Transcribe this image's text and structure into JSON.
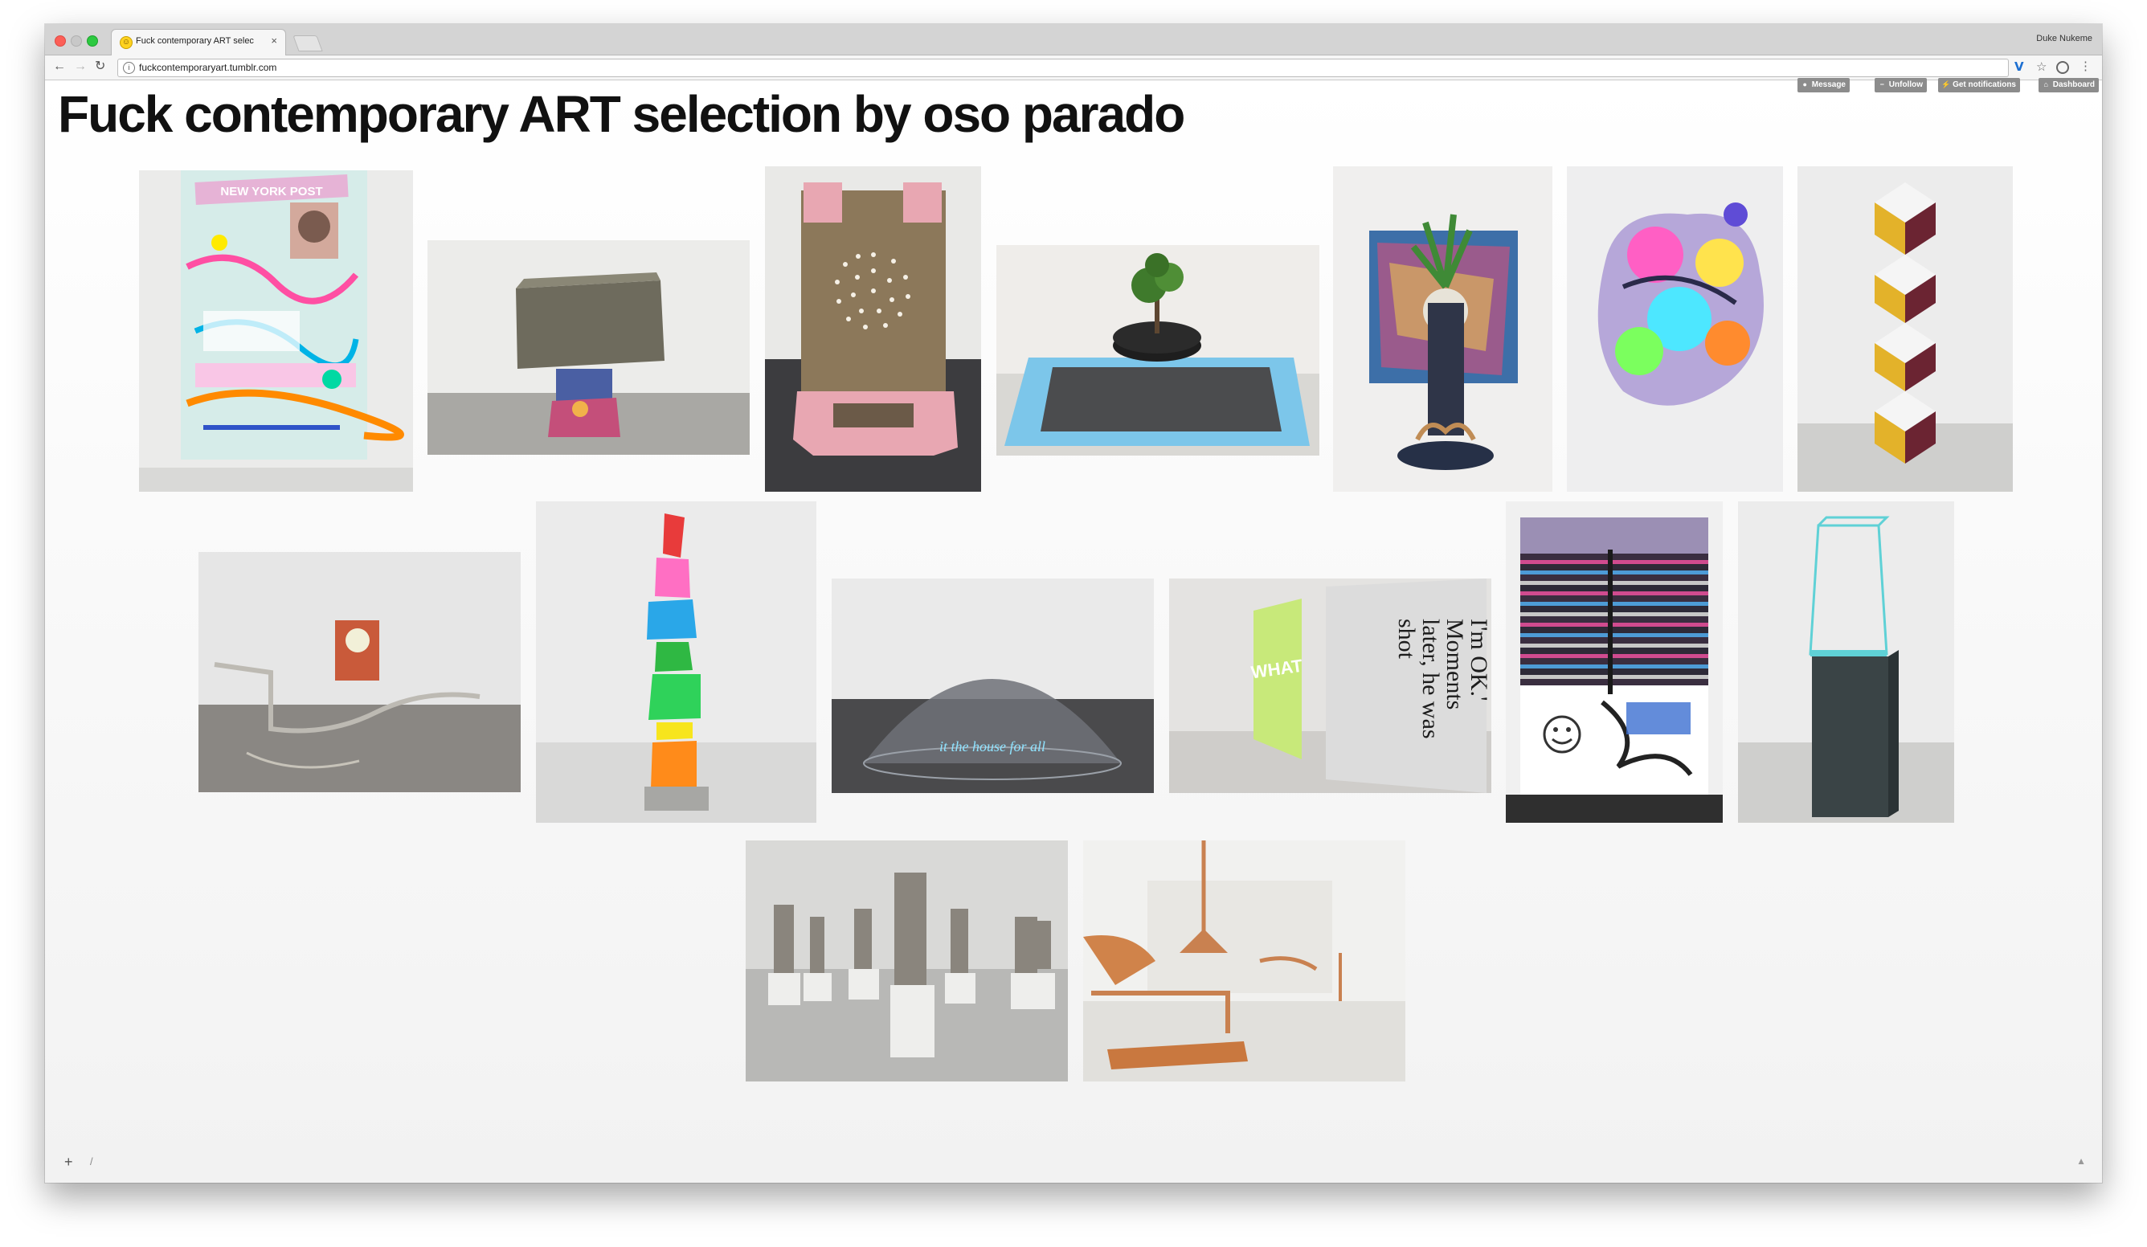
{
  "browser": {
    "tab_title": "Fuck contemporary ART selec",
    "tab_close": "×",
    "profile_name": "Duke Nukeme",
    "url": "fuckcontemporaryart.tumblr.com",
    "info_icon": "i",
    "extension_label": "V",
    "nav": {
      "back": "←",
      "forward": "→",
      "reload": "↻"
    },
    "star": "☆",
    "menu": "⋮",
    "favicon": "☺"
  },
  "blog": {
    "title": "Fuck contemporary ART selection by oso parado",
    "controls": {
      "message": "Message",
      "unfollow": "Unfollow",
      "notifications": "Get notifications",
      "dashboard": "Dashboard"
    }
  },
  "posts": [
    {
      "name": "post-painting-newyorkpost",
      "alt": "Colorful collage painting with newspaper headline"
    },
    {
      "name": "post-concrete-box-sculpture",
      "alt": "Concrete box on dog-food bag sculpture"
    },
    {
      "name": "post-pink-frame-sculpture",
      "alt": "Pink frame with perforated bronze panel"
    },
    {
      "name": "post-tire-plant",
      "alt": "Tire with plant on blue-framed glass"
    },
    {
      "name": "post-plant-sculpture",
      "alt": "Painted panel with plant on dark stand"
    },
    {
      "name": "post-neon-blob-painting",
      "alt": "Neon colored shaped wall painting"
    },
    {
      "name": "post-cube-column",
      "alt": "Stacked yellow and white cube column"
    },
    {
      "name": "post-gallery-branch",
      "alt": "Gallery with branch sculpture and painting"
    },
    {
      "name": "post-rainbow-stack",
      "alt": "Rainbow colored stacked stone sculpture"
    },
    {
      "name": "post-dome-neon",
      "alt": "Mesh dome with neon writing in gallery"
    },
    {
      "name": "post-text-paintings",
      "alt": "Text painting: I'm OK. Moments later, he was shot"
    },
    {
      "name": "post-striped-painting",
      "alt": "Striped fabric painting with smiley graffiti"
    },
    {
      "name": "post-glass-pedestal",
      "alt": "Glass vitrine on dark pedestal"
    },
    {
      "name": "post-gray-figures",
      "alt": "Gray clay figures on white plinths"
    },
    {
      "name": "post-copper-horns",
      "alt": "Copper horns installation in white gallery"
    }
  ],
  "text_paintings": {
    "big": "I'm OK.' Moments later, he was shot",
    "small": "WHAT"
  },
  "painting_headline": "NEW YORK POST",
  "neon_text": "it the house for all",
  "footer": {
    "plus": "+",
    "slash": "/",
    "up": "▲"
  }
}
